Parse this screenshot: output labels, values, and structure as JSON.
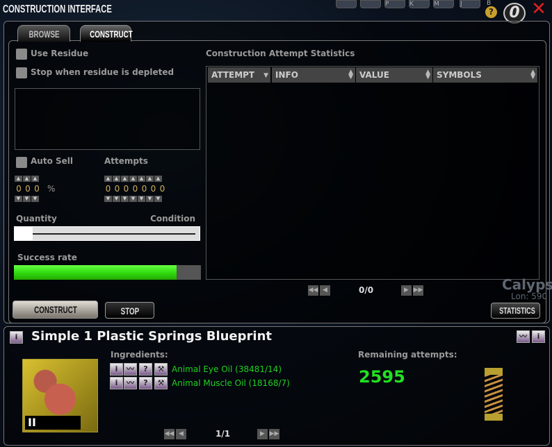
{
  "window": {
    "title": "CONSTRUCTION INTERFACE",
    "help_icon": "?",
    "zero_badge": "0",
    "close_icon": "✕"
  },
  "top_bar_icons": [
    "P",
    "K",
    "M",
    "J",
    "B"
  ],
  "tabs": [
    {
      "label": "BROWSE",
      "active": false
    },
    {
      "label": "CONSTRUCT",
      "active": true
    }
  ],
  "options": {
    "use_residue": "Use Residue",
    "use_residue_checked": false,
    "stop_residue": "Stop when residue is depleted",
    "stop_residue_checked": false,
    "auto_sell": "Auto Sell",
    "auto_sell_checked": false,
    "percent_digits": [
      "0",
      "0",
      "0"
    ],
    "percent_sign": "%",
    "attempts_label": "Attempts",
    "attempts_digits": [
      "0",
      "0",
      "0",
      "0",
      "0",
      "0",
      "0"
    ]
  },
  "slider": {
    "left_label": "Quantity",
    "right_label": "Condition",
    "value": 0
  },
  "success": {
    "label": "Success rate",
    "fraction": 0.87,
    "color": "#33dd11"
  },
  "buttons": {
    "construct": "CONSTRUCT",
    "stop": "STOP",
    "statistics": "STATISTICS"
  },
  "stats": {
    "title": "Construction Attempt Statistics",
    "columns": [
      "ATTEMPT",
      "INFO",
      "VALUE",
      "SYMBOLS"
    ],
    "rows": [],
    "pager": "0/0"
  },
  "blueprint": {
    "title": "Simple 1 Plastic Springs Blueprint",
    "ingredients_label": "Ingredients:",
    "ingredients": [
      {
        "name": "Animal Eye Oil (38481/14)"
      },
      {
        "name": "Animal Muscle Oil (18168/7)"
      }
    ],
    "remaining_label": "Remaining attempts:",
    "remaining_value": "2595",
    "pager": "1/1",
    "blueprint_tier_mark": "II"
  },
  "background_text": {
    "planet": "Calypso",
    "lon": "Lon: 590"
  }
}
